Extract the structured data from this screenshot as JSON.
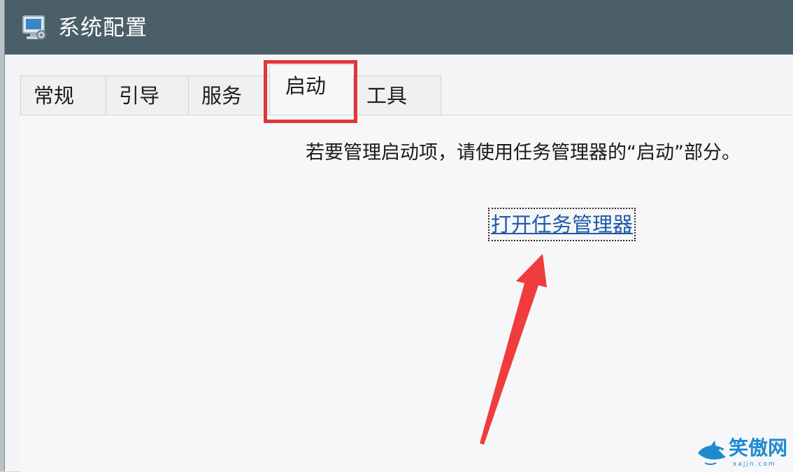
{
  "window": {
    "title": "系统配置",
    "icon": "system-config-icon"
  },
  "tabs": [
    {
      "label": "常规",
      "active": false
    },
    {
      "label": "引导",
      "active": false
    },
    {
      "label": "服务",
      "active": false
    },
    {
      "label": "启动",
      "active": true
    },
    {
      "label": "工具",
      "active": false
    }
  ],
  "startup_panel": {
    "info_text": "若要管理启动项，请使用任务管理器的“启动”部分。",
    "link_text": "打开任务管理器"
  },
  "annotation": {
    "highlight_color": "#e0353a",
    "arrow_color": "#f03c3c",
    "arrow_icon": "red-arrow-pointer"
  },
  "watermark": {
    "text": "笑傲网",
    "url": "xajjn.com",
    "icon": "shark-logo-icon",
    "color": "#1e8bd1"
  }
}
